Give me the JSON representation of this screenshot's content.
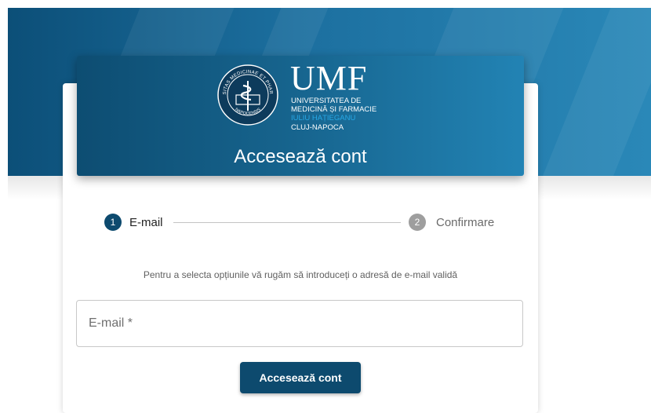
{
  "header": {
    "logo": {
      "abbr": "UMF",
      "line1": "UNIVERSITATEA DE",
      "line2": "MEDICINĂ ȘI FARMACIE",
      "line3": "IULIU HAȚIEGANU",
      "line4": "CLUJ-NAPOCA",
      "seal_text": "UNIVERSITAS MEDICINAE ET PHARMACIAE NAPOCENSIS"
    },
    "title": "Accesează cont"
  },
  "stepper": {
    "steps": [
      {
        "number": "1",
        "label": "E-mail",
        "state": "active"
      },
      {
        "number": "2",
        "label": "Confirmare",
        "state": "inactive"
      }
    ]
  },
  "form": {
    "instructions": "Pentru a selecta opțiunile vă rugăm să introduceți o adresă de e-mail validă",
    "email": {
      "placeholder": "E-mail *",
      "value": ""
    },
    "submit_label": "Accesează cont"
  },
  "colors": {
    "primary": "#0d4a6e",
    "banner": "#1c6f9f",
    "inactive_step": "#9e9e9e",
    "logo_accent": "#27a8e6"
  },
  "icons": {
    "logo": "university-seal-icon"
  }
}
